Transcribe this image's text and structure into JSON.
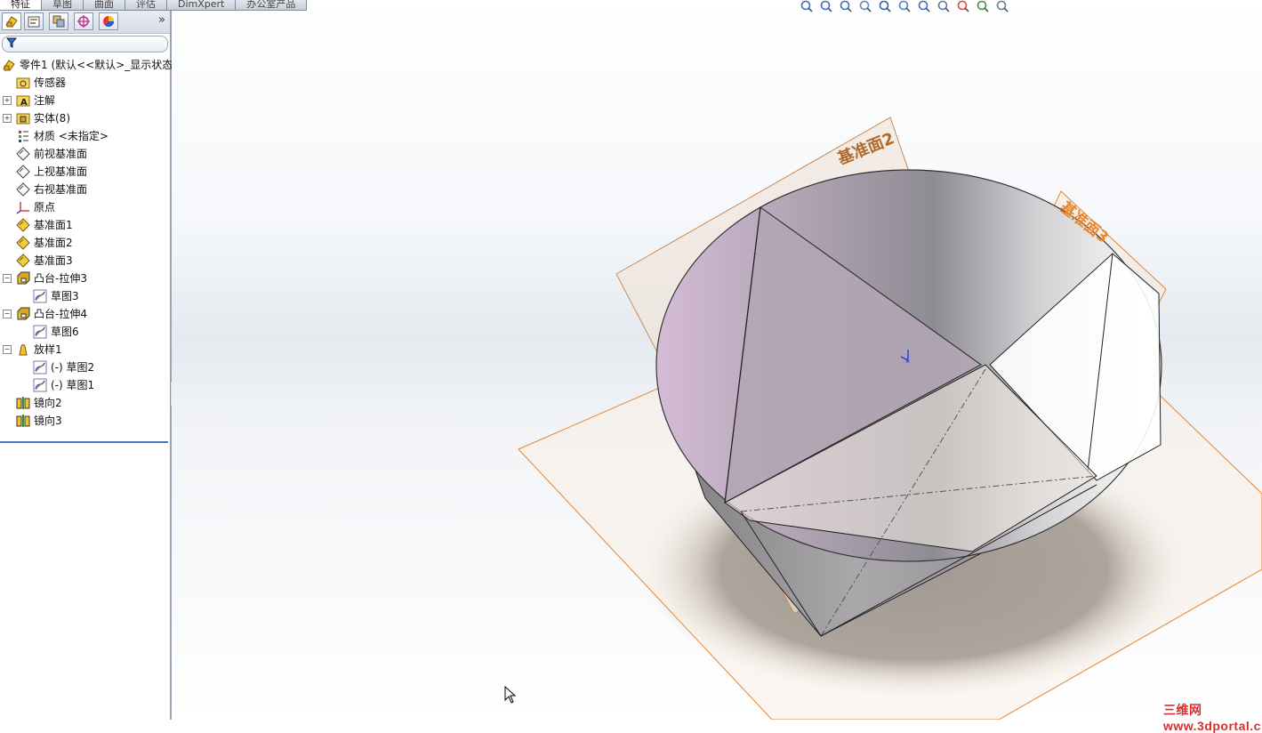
{
  "command_tabs": [
    "特征",
    "草图",
    "曲面",
    "评估",
    "DimXpert",
    "办公室产品"
  ],
  "panel": {
    "tabs": [
      "feature-manager-icon",
      "property-manager-icon",
      "configuration-manager-icon",
      "dimxpert-manager-icon",
      "display-manager-icon"
    ],
    "more": "»"
  },
  "tree": [
    {
      "label": "零件1  (默认<<默认>_显示状态",
      "icon": "part-icon",
      "level": 0,
      "expander": ""
    },
    {
      "label": "传感器",
      "icon": "sensor-folder-icon",
      "level": 1,
      "expander": ""
    },
    {
      "label": "注解",
      "icon": "annotation-folder-icon",
      "level": 1,
      "expander": "+"
    },
    {
      "label": "实体(8)",
      "icon": "solid-bodies-folder-icon",
      "level": 1,
      "expander": "+"
    },
    {
      "label": "材质 <未指定>",
      "icon": "material-icon",
      "level": 1,
      "expander": ""
    },
    {
      "label": "前视基准面",
      "icon": "plane-icon",
      "level": 1,
      "expander": ""
    },
    {
      "label": "上视基准面",
      "icon": "plane-icon",
      "level": 1,
      "expander": ""
    },
    {
      "label": "右视基准面",
      "icon": "plane-icon",
      "level": 1,
      "expander": ""
    },
    {
      "label": "原点",
      "icon": "origin-icon",
      "level": 1,
      "expander": ""
    },
    {
      "label": "基准面1",
      "icon": "ref-plane-icon",
      "level": 1,
      "expander": ""
    },
    {
      "label": "基准面2",
      "icon": "ref-plane-icon",
      "level": 1,
      "expander": ""
    },
    {
      "label": "基准面3",
      "icon": "ref-plane-icon",
      "level": 1,
      "expander": ""
    },
    {
      "label": "凸台-拉伸3",
      "icon": "extrude-icon",
      "level": 1,
      "expander": "−"
    },
    {
      "label": "草图3",
      "icon": "sketch-icon",
      "level": 2,
      "expander": ""
    },
    {
      "label": "凸台-拉伸4",
      "icon": "extrude-icon",
      "level": 1,
      "expander": "−"
    },
    {
      "label": "草图6",
      "icon": "sketch-icon",
      "level": 2,
      "expander": ""
    },
    {
      "label": "放样1",
      "icon": "loft-icon",
      "level": 1,
      "expander": "−"
    },
    {
      "label": "(-) 草图2",
      "icon": "sketch-icon",
      "level": 2,
      "expander": ""
    },
    {
      "label": "(-) 草图1",
      "icon": "sketch-icon",
      "level": 2,
      "expander": ""
    },
    {
      "label": "镜向2",
      "icon": "mirror-icon",
      "level": 1,
      "expander": ""
    },
    {
      "label": "镜向3",
      "icon": "mirror-icon",
      "level": 1,
      "expander": ""
    }
  ],
  "view_toolbar": [
    "zoom-to-fit-icon",
    "zoom-area-icon",
    "previous-view-icon",
    "section-view-icon",
    "dynamic-annotation-icon",
    "view-orientation-icon",
    "display-style-icon",
    "hide-show-icon",
    "appearance-icon",
    "scene-icon",
    "view-settings-icon"
  ],
  "viewport": {
    "plane_labels": [
      "基准面2",
      "基准面3"
    ],
    "watermark": "三维网www.3dportal.cn"
  },
  "colors": {
    "plane_edge": "#e8862e",
    "plane_label": "#b06a2c",
    "tree_separator": "#4a78b8",
    "watermark": "#d72f2f"
  }
}
